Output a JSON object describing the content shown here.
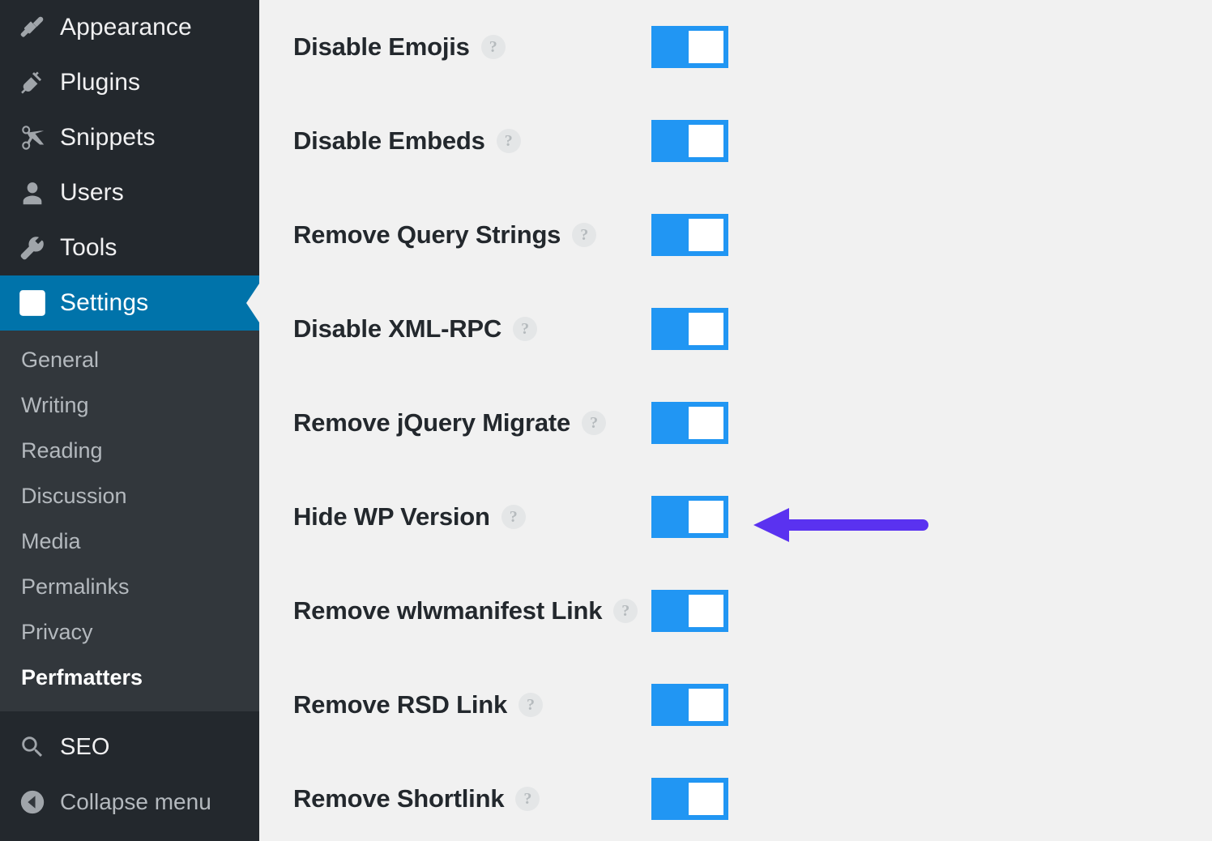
{
  "sidebar": {
    "bg_color": "#23282d",
    "submenu_bg_color": "#32373c",
    "active_color": "#0073aa",
    "top_items": [
      {
        "label": "Appearance",
        "icon": "paintbrush-icon"
      },
      {
        "label": "Plugins",
        "icon": "plug-icon"
      },
      {
        "label": "Snippets",
        "icon": "scissors-icon"
      },
      {
        "label": "Users",
        "icon": "user-icon"
      },
      {
        "label": "Tools",
        "icon": "wrench-icon"
      },
      {
        "label": "Settings",
        "icon": "settings-sliders-icon"
      }
    ],
    "submenu_items": [
      {
        "label": "General"
      },
      {
        "label": "Writing"
      },
      {
        "label": "Reading"
      },
      {
        "label": "Discussion"
      },
      {
        "label": "Media"
      },
      {
        "label": "Permalinks"
      },
      {
        "label": "Privacy"
      },
      {
        "label": "Perfmatters"
      }
    ],
    "bottom_items": [
      {
        "label": "SEO",
        "icon": "search-icon"
      }
    ],
    "collapse": {
      "label": "Collapse menu",
      "icon": "collapse-arrow-icon"
    }
  },
  "main": {
    "bg_color": "#f1f1f1",
    "toggle_on_color": "#2196f3",
    "help_glyph": "?",
    "options": [
      {
        "label": "Disable Emojis",
        "state": "on"
      },
      {
        "label": "Disable Embeds",
        "state": "on"
      },
      {
        "label": "Remove Query Strings",
        "state": "on"
      },
      {
        "label": "Disable XML-RPC",
        "state": "on"
      },
      {
        "label": "Remove jQuery Migrate",
        "state": "on"
      },
      {
        "label": "Hide WP Version",
        "state": "on"
      },
      {
        "label": "Remove wlwmanifest Link",
        "state": "on"
      },
      {
        "label": "Remove RSD Link",
        "state": "on"
      },
      {
        "label": "Remove Shortlink",
        "state": "on"
      }
    ]
  },
  "annotation": {
    "arrow": {
      "name": "highlight-arrow",
      "direction": "left",
      "color": "#5a32f0",
      "points_at": "Hide WP Version"
    }
  }
}
